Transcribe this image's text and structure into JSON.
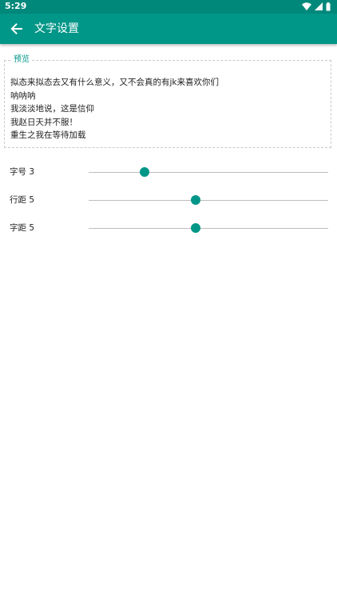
{
  "status_bar": {
    "time": "5:29",
    "icons": [
      "wifi-icon",
      "cellular-signal-icon",
      "battery-icon"
    ]
  },
  "toolbar": {
    "back_icon": "arrow-back-icon",
    "title": "文字设置",
    "color": "#009688"
  },
  "preview": {
    "legend": "预览",
    "lines": [
      "拟态来拟态去又有什么意义，又不会真的有jk来喜欢你们",
      "呐呐呐",
      "我淡淡地说，这是信仰",
      "我赵日天并不服！",
      "重生之我在等待加载"
    ]
  },
  "settings": [
    {
      "label": "字号 3",
      "value_fraction": 0.233
    },
    {
      "label": "行距 5",
      "value_fraction": 0.445
    },
    {
      "label": "字距 5",
      "value_fraction": 0.445
    }
  ],
  "colors": {
    "accent": "#009688",
    "status_bar": "#00897b",
    "track": "#bdbdbd"
  }
}
